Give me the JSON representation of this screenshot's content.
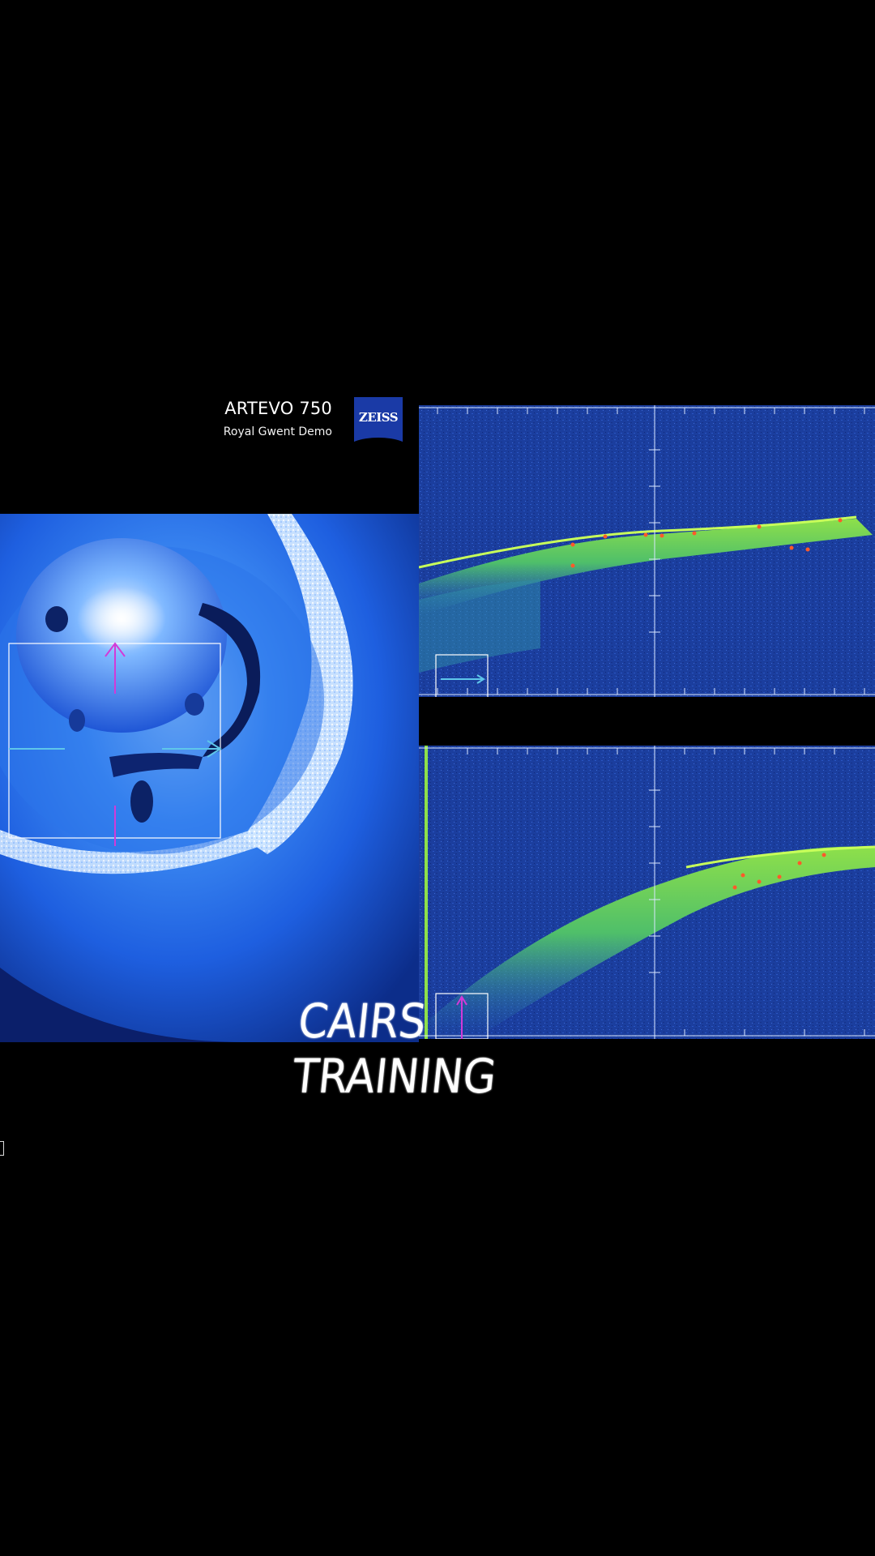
{
  "header": {
    "title": "ARTEVO 750",
    "subtitle": "Royal Gwent Demo",
    "logo_text": "ZEISS"
  },
  "watermark": {
    "text": "CAIRS TRAINING"
  },
  "colors": {
    "oct_background": "#1b3e9e",
    "oct_signal": "#6fd04a",
    "logo_blue": "#1a3aa6",
    "crosshair_magenta": "#d23ad8",
    "crosshair_cyan": "#5fc6ea"
  }
}
